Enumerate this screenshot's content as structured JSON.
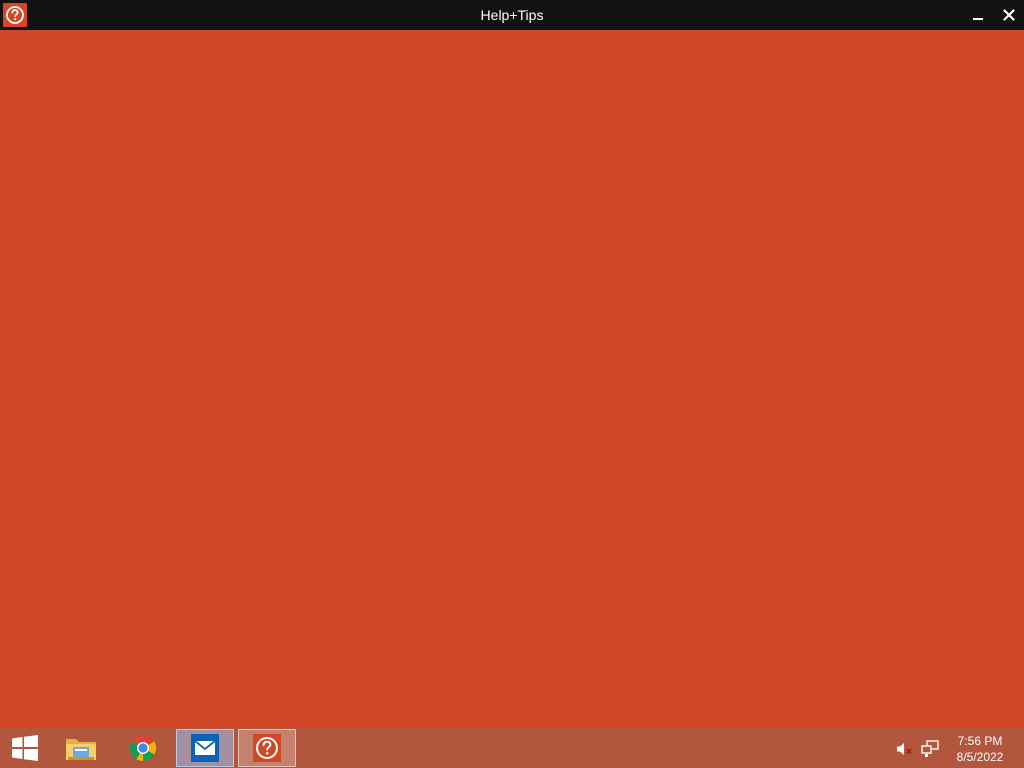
{
  "window": {
    "title": "Help+Tips",
    "app_icon": "help-question-icon",
    "minimize_icon": "minimize-icon",
    "close_icon": "close-icon"
  },
  "colors": {
    "accent": "#d24726",
    "titlebar": "#121212",
    "taskbar": "#b2573d"
  },
  "taskbar": {
    "items": [
      {
        "name": "start",
        "icon": "windows-logo-icon"
      },
      {
        "name": "file-explorer",
        "icon": "folder-icon"
      },
      {
        "name": "chrome",
        "icon": "chrome-icon"
      },
      {
        "name": "mail",
        "icon": "mail-icon"
      },
      {
        "name": "help-tips",
        "icon": "help-question-icon"
      }
    ],
    "tray": {
      "volume_icon": "volume-muted-icon",
      "network_icon": "network-icon"
    },
    "clock": {
      "time": "7:56 PM",
      "date": "8/5/2022"
    }
  }
}
